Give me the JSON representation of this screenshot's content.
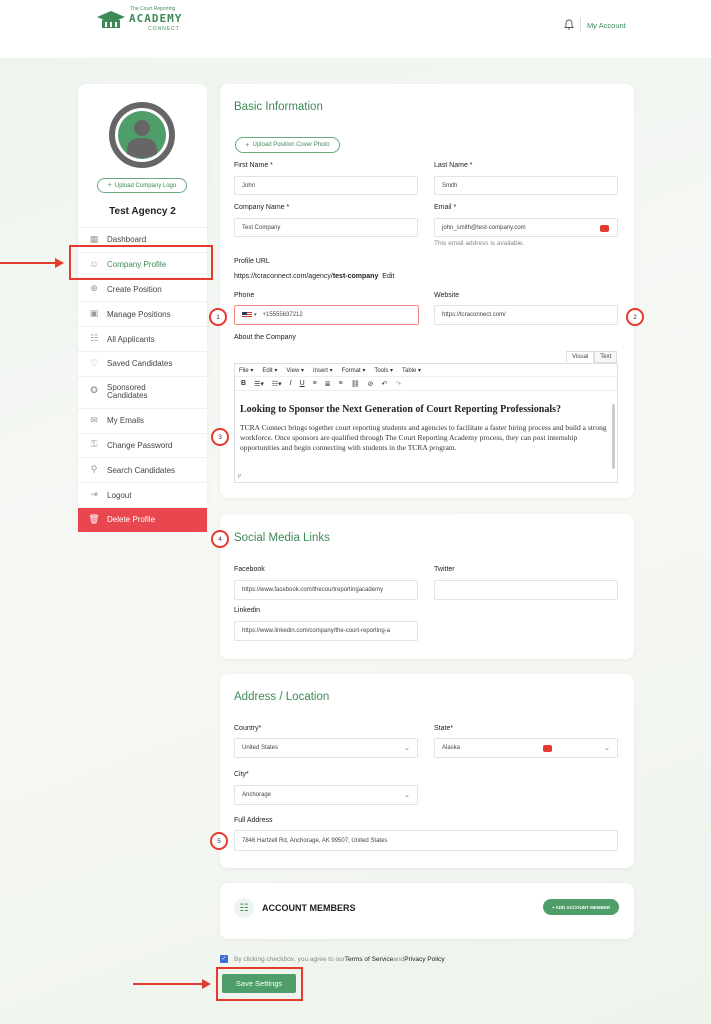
{
  "header": {
    "logo_small": "The Court Reporting",
    "logo_main": "ACADEMY",
    "logo_sub": "CONNECT",
    "my_account": "My Account"
  },
  "sidebar": {
    "upload_logo": "Upload Company Logo",
    "agency_name": "Test Agency 2",
    "items": [
      {
        "label": "Dashboard",
        "icon": "dashboard-icon"
      },
      {
        "label": "Company Profile",
        "icon": "user-icon"
      },
      {
        "label": "Create Position",
        "icon": "plus-circle-icon"
      },
      {
        "label": "Manage Positions",
        "icon": "briefcase-icon"
      },
      {
        "label": "All Applicants",
        "icon": "users-icon"
      },
      {
        "label": "Saved Candidates",
        "icon": "heart-icon"
      },
      {
        "label": "Sponsored Candidates",
        "icon": "badge-icon"
      },
      {
        "label": "My Emails",
        "icon": "mail-icon"
      },
      {
        "label": "Change Password",
        "icon": "lock-icon"
      },
      {
        "label": "Search Candidates",
        "icon": "search-icon"
      },
      {
        "label": "Logout",
        "icon": "logout-icon"
      },
      {
        "label": "Delete Profile",
        "icon": "trash-icon"
      }
    ]
  },
  "basic": {
    "title": "Basic Information",
    "upload_cover": "Upload Position Cover Photo",
    "first_name_label": "First Name *",
    "first_name": "John",
    "last_name_label": "Last Name *",
    "last_name": "Smith",
    "company_label": "Company Name *",
    "company": "Test Company",
    "email_label": "Email *",
    "email": "john_smith@test-company.com",
    "email_hint": "This email address is available.",
    "profile_url_label": "Profile URL",
    "profile_url_prefix": "https://tcraconnect.com/agency/",
    "profile_url_slug": "test-company",
    "profile_url_edit": "Edit",
    "phone_label": "Phone",
    "phone": "+15555637212",
    "website_label": "Website",
    "website": "https://tcraconnect.com/",
    "about_label": "About the Company",
    "tab_visual": "Visual",
    "tab_text": "Text",
    "menu": [
      "File ▾",
      "Edit ▾",
      "View ▾",
      "Insert ▾",
      "Format ▾",
      "Tools ▾",
      "Table ▾"
    ],
    "about_heading": "Looking to Sponsor the Next Generation of Court Reporting Professionals?",
    "about_body": "TCRA Connect brings together court reporting students and agencies to facilitate a faster hiring process and build a strong workforce. Once sponsors are qualified through The Court Reporting Academy process, they can post internship opportunities and begin connecting with students in the TCRA program.",
    "editor_status": "P"
  },
  "social": {
    "title": "Social Media Links",
    "facebook_label": "Facebook",
    "facebook": "https://www.facebook.com/thecourtreportingacademy",
    "twitter_label": "Twitter",
    "twitter": "",
    "linkedin_label": "Linkedin",
    "linkedin": "https://www.linkedin.com/company/the-court-reporting-a"
  },
  "address": {
    "title": "Address / Location",
    "country_label": "Country*",
    "country": "United States",
    "state_label": "State*",
    "state": "Alaska",
    "city_label": "City*",
    "city": "Anchorage",
    "full_label": "Full Address",
    "full": "7846 Hartzell Rd, Anchorage, AK 99507, United States"
  },
  "members": {
    "title": "ACCOUNT MEMBERS",
    "add_button": "+ ADD ACCOUNT MEMBER"
  },
  "footer": {
    "terms_prefix": "By clicking checkbox, you agree to our ",
    "terms_link": "Terms of Service",
    "terms_and": " and ",
    "privacy_link": "Privacy Policy",
    "save": "Save Settings"
  },
  "annotations": [
    "1",
    "2",
    "3",
    "4",
    "5"
  ],
  "colors": {
    "accent": "#3e8a57",
    "highlight": "#e53a2e",
    "danger": "#e8474f"
  }
}
